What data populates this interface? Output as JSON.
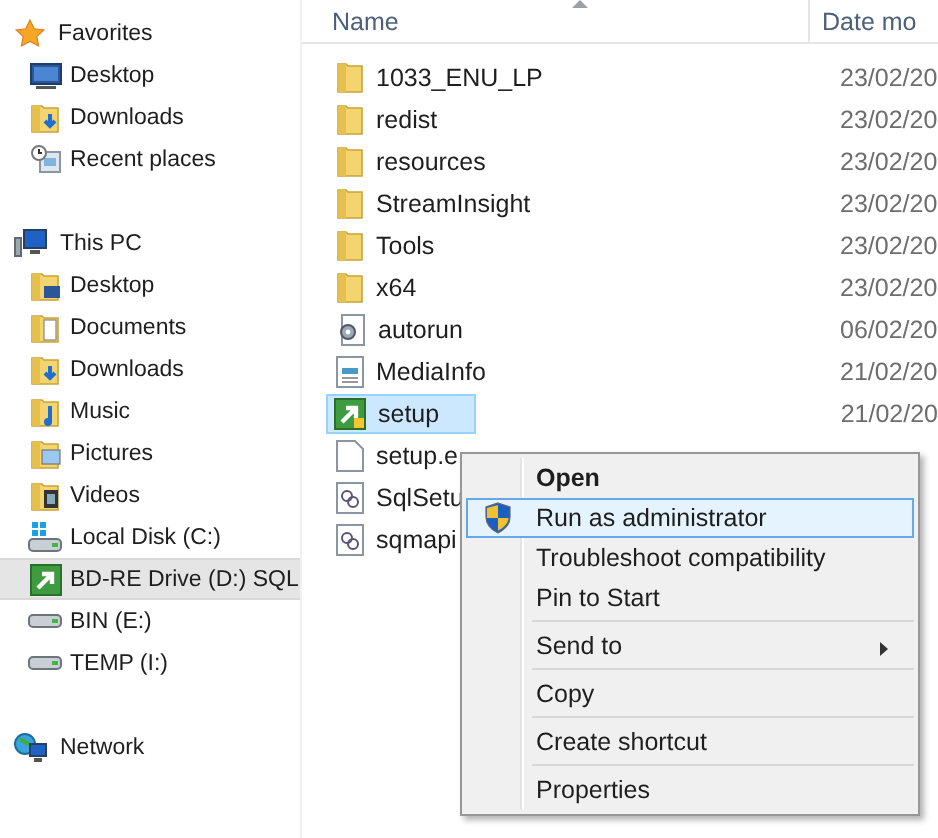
{
  "sidebar": {
    "groups": [
      {
        "label": "Favorites",
        "items": [
          {
            "label": "Desktop",
            "selected": false
          },
          {
            "label": "Downloads",
            "selected": false
          },
          {
            "label": "Recent places",
            "selected": false
          }
        ]
      },
      {
        "label": "This PC",
        "items": [
          {
            "label": "Desktop",
            "selected": false
          },
          {
            "label": "Documents",
            "selected": false
          },
          {
            "label": "Downloads",
            "selected": false
          },
          {
            "label": "Music",
            "selected": false
          },
          {
            "label": "Pictures",
            "selected": false
          },
          {
            "label": "Videos",
            "selected": false
          },
          {
            "label": "Local Disk (C:)",
            "selected": false
          },
          {
            "label": "BD-RE Drive (D:) SQL",
            "selected": true
          },
          {
            "label": "BIN (E:)",
            "selected": false
          },
          {
            "label": "TEMP (I:)",
            "selected": false
          }
        ]
      },
      {
        "label": "Network"
      }
    ]
  },
  "file_list": {
    "columns": [
      "Name",
      "Date mo"
    ],
    "rows": [
      {
        "name": "1033_ENU_LP",
        "date": "23/02/20",
        "kind": "folder",
        "selected": false
      },
      {
        "name": "redist",
        "date": "23/02/20",
        "kind": "folder",
        "selected": false
      },
      {
        "name": "resources",
        "date": "23/02/20",
        "kind": "folder",
        "selected": false
      },
      {
        "name": "StreamInsight",
        "date": "23/02/20",
        "kind": "folder",
        "selected": false
      },
      {
        "name": "Tools",
        "date": "23/02/20",
        "kind": "folder",
        "selected": false
      },
      {
        "name": "x64",
        "date": "23/02/20",
        "kind": "folder",
        "selected": false
      },
      {
        "name": "autorun",
        "date": "06/02/20",
        "kind": "settings",
        "selected": false
      },
      {
        "name": "MediaInfo",
        "date": "21/02/20",
        "kind": "info",
        "selected": false
      },
      {
        "name": "setup",
        "date": "21/02/20",
        "kind": "setup",
        "selected": true
      },
      {
        "name": "setup.e",
        "kind": "blank",
        "selected": false
      },
      {
        "name": "SqlSetu",
        "kind": "library",
        "selected": false
      },
      {
        "name": "sqmapi",
        "kind": "library",
        "selected": false
      }
    ]
  },
  "context_menu": {
    "items": [
      {
        "kind": "item",
        "label": "Open",
        "default": true,
        "selected": false
      },
      {
        "kind": "elevated",
        "label": "Run as administrator",
        "default": false,
        "selected": true
      },
      {
        "kind": "item",
        "label": "Troubleshoot compatibility",
        "default": false,
        "selected": false
      },
      {
        "kind": "item",
        "label": "Pin to Start",
        "default": false,
        "selected": false
      },
      {
        "kind": "separator"
      },
      {
        "kind": "submenu",
        "label": "Send to",
        "default": false,
        "selected": false
      },
      {
        "kind": "separator"
      },
      {
        "kind": "item",
        "label": "Copy",
        "default": false,
        "selected": false
      },
      {
        "kind": "separator"
      },
      {
        "kind": "item",
        "label": "Create shortcut",
        "default": false,
        "selected": false
      },
      {
        "kind": "separator"
      },
      {
        "kind": "item",
        "label": "Properties",
        "default": false,
        "selected": false
      }
    ]
  }
}
